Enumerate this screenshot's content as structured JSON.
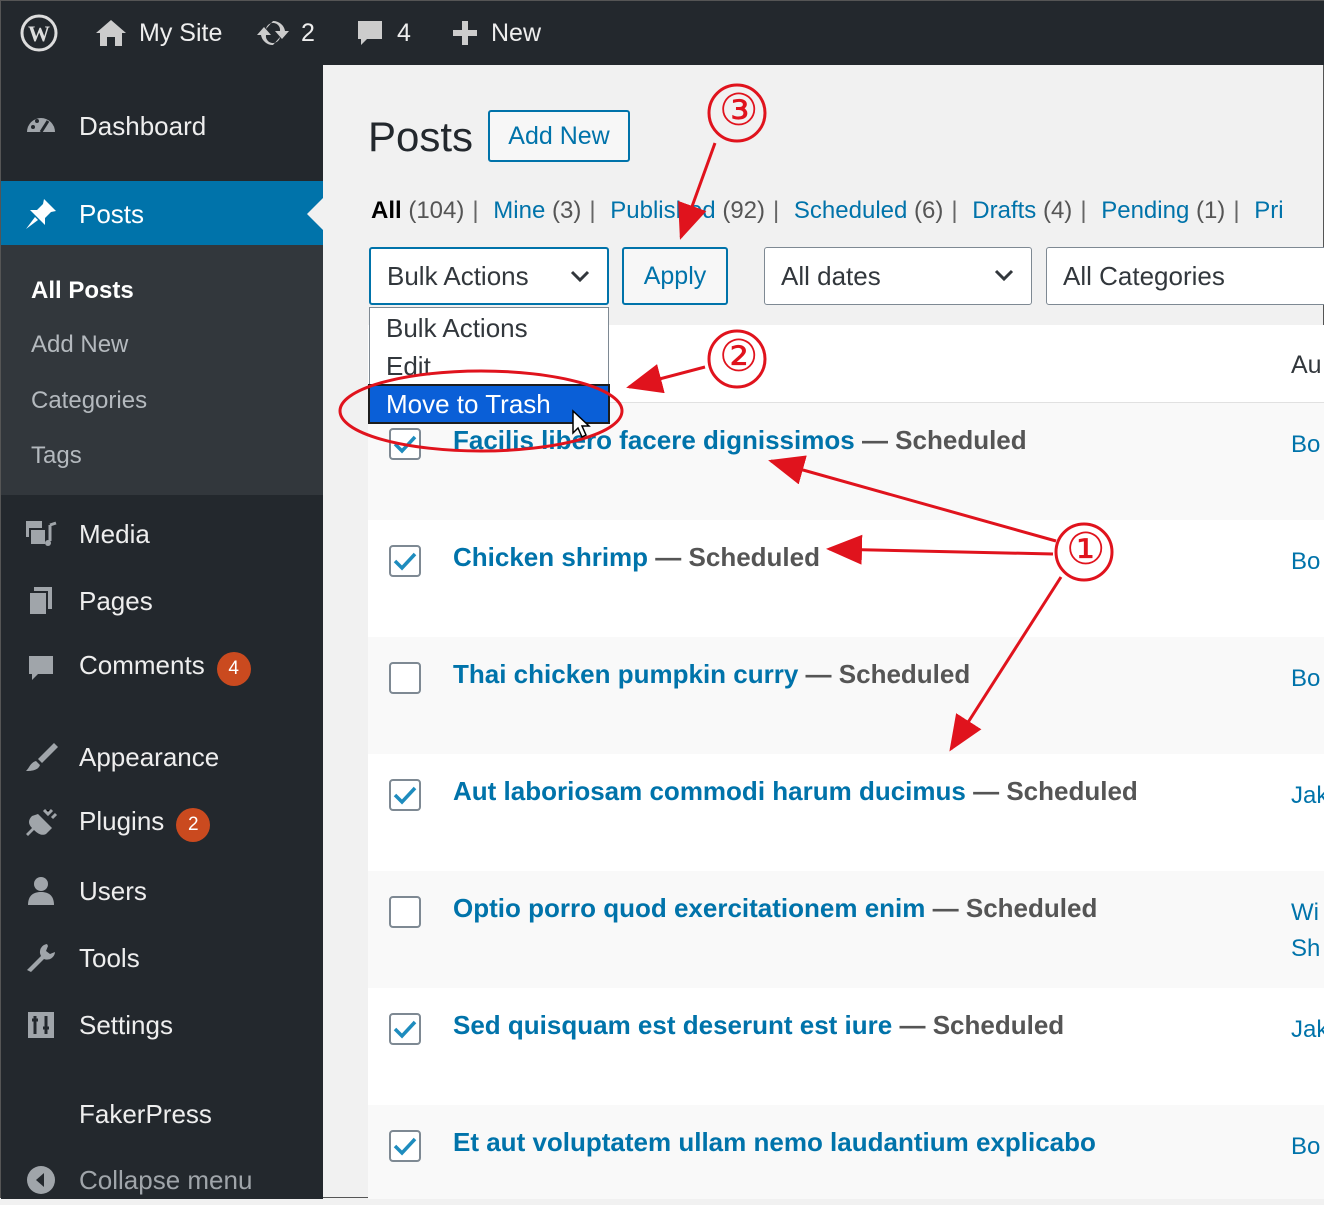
{
  "admin_bar": {
    "site_name": "My Site",
    "updates_count": "2",
    "comments_count": "4",
    "new_label": "New"
  },
  "menu": {
    "dashboard": "Dashboard",
    "posts": "Posts",
    "posts_sub": {
      "all_posts": "All Posts",
      "add_new": "Add New",
      "categories": "Categories",
      "tags": "Tags"
    },
    "media": "Media",
    "pages": "Pages",
    "comments": "Comments",
    "comments_badge": "4",
    "appearance": "Appearance",
    "plugins": "Plugins",
    "plugins_badge": "2",
    "users": "Users",
    "tools": "Tools",
    "settings": "Settings",
    "fakerpress": "FakerPress",
    "collapse": "Collapse menu"
  },
  "page": {
    "title": "Posts",
    "add_new_label": "Add New",
    "filters": {
      "all": "All",
      "all_count": "(104)",
      "mine": "Mine",
      "mine_count": "(3)",
      "published": "Published",
      "published_count": "(92)",
      "scheduled": "Scheduled",
      "scheduled_count": "(6)",
      "drafts": "Drafts",
      "drafts_count": "(4)",
      "pending": "Pending",
      "pending_count": "(1)",
      "private_partial": "Pri"
    },
    "bulk_actions": "Bulk Actions",
    "apply": "Apply",
    "dates": "All dates",
    "categories": "All Categories",
    "dropdown_options": [
      "Bulk Actions",
      "Edit",
      "Move to Trash"
    ],
    "author_header": "Au"
  },
  "posts": [
    {
      "title": "Facilis libero facere dignissimos",
      "state": "— Scheduled",
      "author": "Bo",
      "checked": true
    },
    {
      "title": "Chicken shrimp",
      "state": "— Scheduled",
      "author": "Bo",
      "checked": true
    },
    {
      "title": "Thai chicken pumpkin curry",
      "state": "— Scheduled",
      "author": "Bo",
      "checked": false
    },
    {
      "title": "Aut laboriosam commodi harum ducimus",
      "state": "— Scheduled",
      "author": "Jak",
      "checked": true
    },
    {
      "title": "Optio porro quod exercitationem enim",
      "state": "— Scheduled",
      "author": "Wi\nSh",
      "checked": false
    },
    {
      "title": "Sed quisquam est deserunt est iure",
      "state": "— Scheduled",
      "author": "Jak",
      "checked": true
    },
    {
      "title": "Et aut voluptatem ullam nemo laudantium explicabo",
      "state": "",
      "author": "Bo",
      "checked": true
    }
  ],
  "annotations": {
    "step1": "①",
    "step2": "②",
    "step3": "③"
  },
  "colors": {
    "admin_bg": "#23282d",
    "accent": "#0073aa",
    "badge": "#ca4a1f",
    "annotation": "#e0131d"
  }
}
